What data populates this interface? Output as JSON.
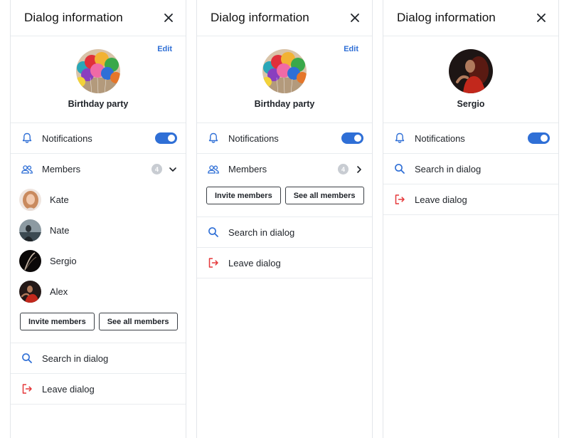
{
  "colors": {
    "accent": "#2f6fd6",
    "danger": "#e5393b",
    "badge": "#c8ccd2"
  },
  "panels": [
    {
      "title": "Dialog information",
      "edit_label": "Edit",
      "name": "Birthday party",
      "notifications_label": "Notifications",
      "notifications_on": true,
      "members_label": "Members",
      "members_count": "4",
      "members": [
        "Kate",
        "Nate",
        "Sergio",
        "Alex"
      ],
      "invite_label": "Invite members",
      "see_all_label": "See all members",
      "search_label": "Search in dialog",
      "leave_label": "Leave dialog"
    },
    {
      "title": "Dialog information",
      "edit_label": "Edit",
      "name": "Birthday party",
      "notifications_label": "Notifications",
      "notifications_on": true,
      "members_label": "Members",
      "members_count": "4",
      "invite_label": "Invite members",
      "see_all_label": "See all members",
      "search_label": "Search in dialog",
      "leave_label": "Leave dialog"
    },
    {
      "title": "Dialog information",
      "name": "Sergio",
      "notifications_label": "Notifications",
      "notifications_on": true,
      "search_label": "Search in dialog",
      "leave_label": "Leave dialog"
    }
  ]
}
